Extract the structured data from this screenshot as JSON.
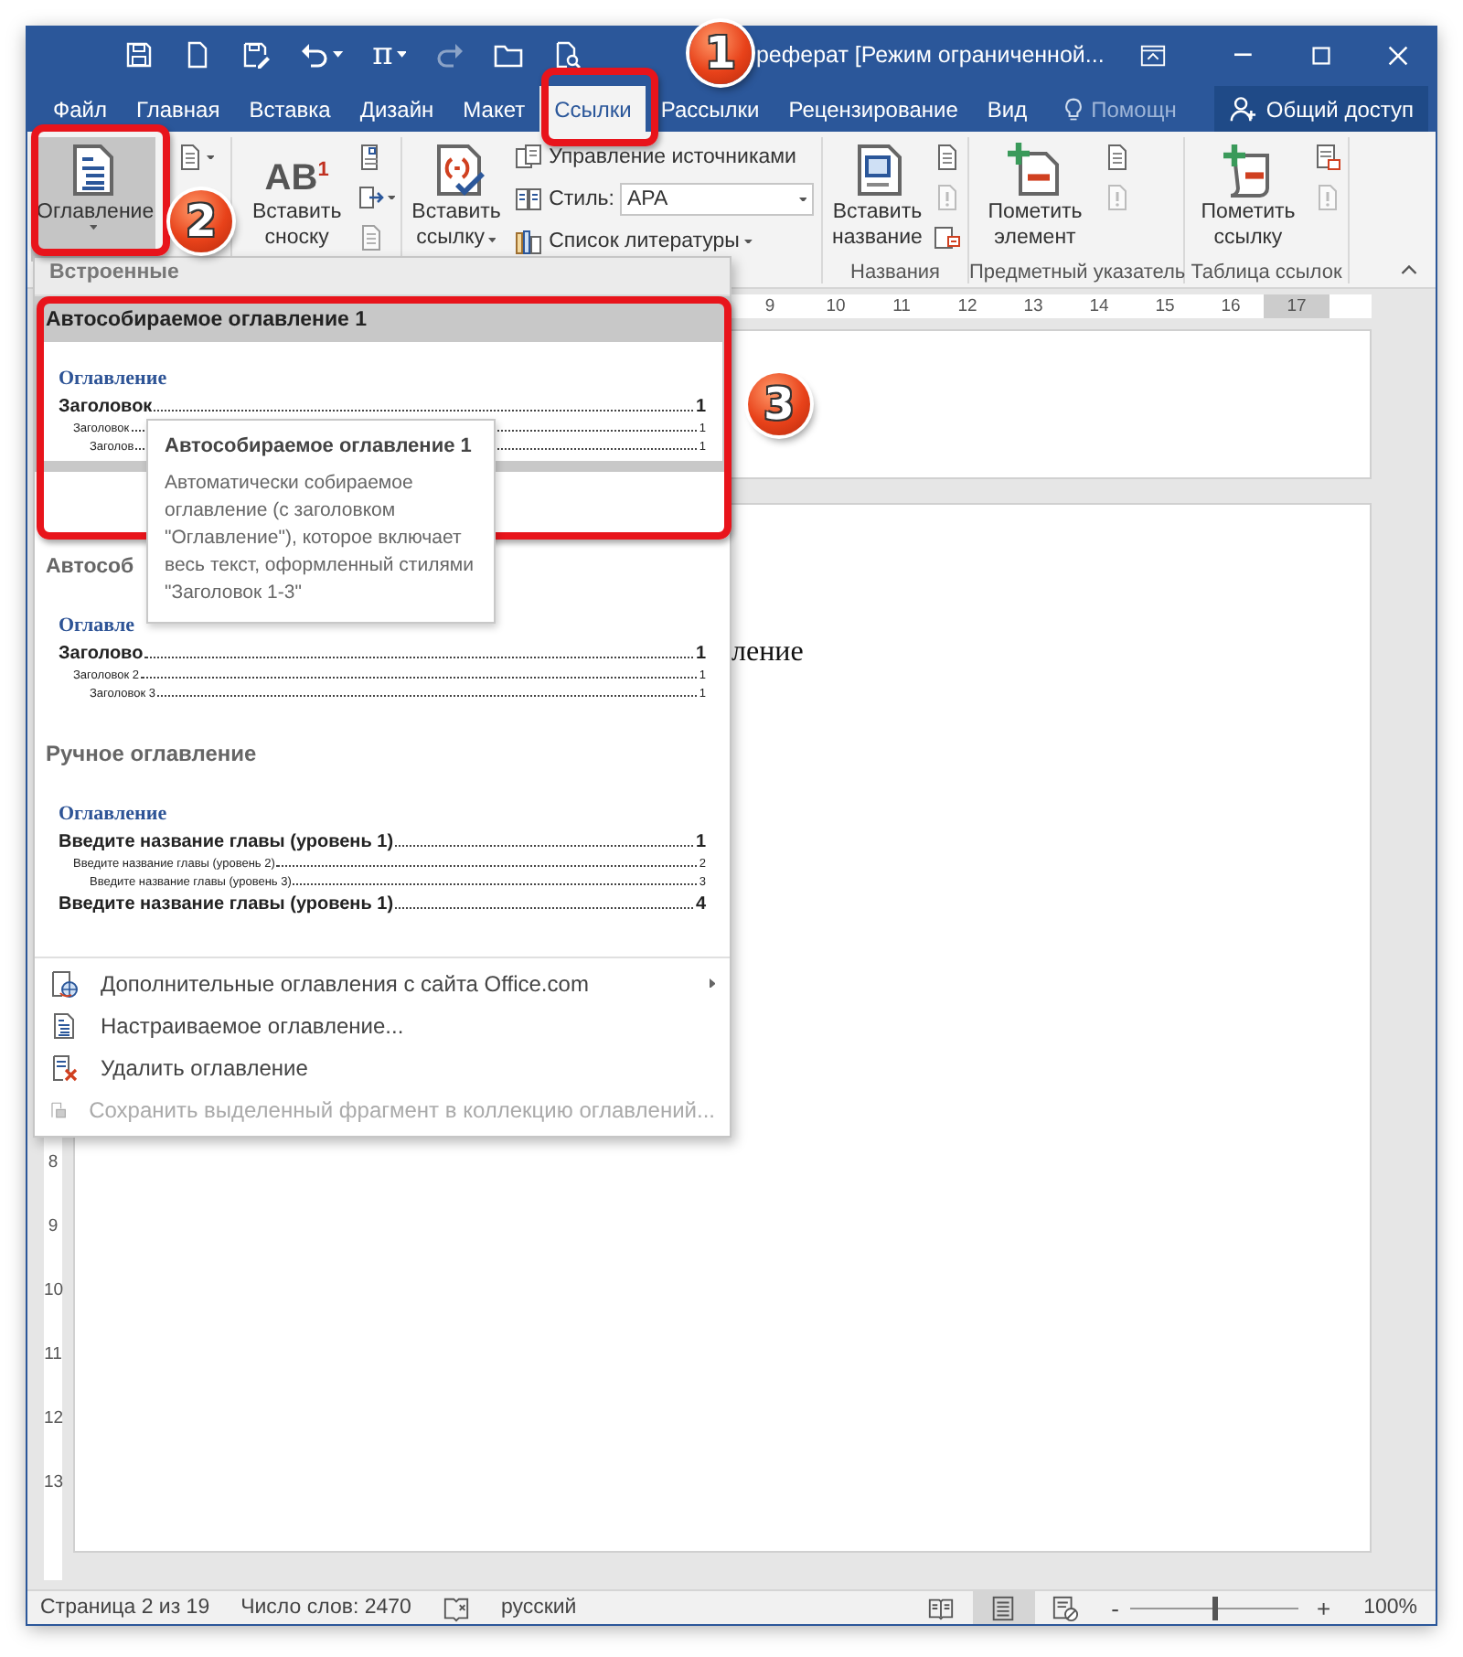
{
  "quick_access": [
    {
      "kind": "save",
      "caret": false,
      "disabled": false
    },
    {
      "kind": "new",
      "caret": false,
      "disabled": false
    },
    {
      "kind": "saveas",
      "caret": false,
      "disabled": false
    },
    {
      "kind": "undo",
      "caret": true,
      "disabled": false
    },
    {
      "kind": "equation",
      "glyph": "π",
      "caret": true,
      "disabled": false
    },
    {
      "kind": "redo",
      "caret": false,
      "disabled": true
    },
    {
      "kind": "open",
      "caret": false,
      "disabled": false
    },
    {
      "kind": "preview",
      "caret": false,
      "disabled": false
    }
  ],
  "window": {
    "title": "реферат [Режим ограниченной..."
  },
  "tabs": [
    {
      "label": "Файл",
      "selected": false
    },
    {
      "label": "Главная",
      "selected": false
    },
    {
      "label": "Вставка",
      "selected": false
    },
    {
      "label": "Дизайн",
      "selected": false
    },
    {
      "label": "Макет",
      "selected": false
    },
    {
      "label": "Ссылки",
      "selected": true
    },
    {
      "label": "Рассылки",
      "selected": false
    },
    {
      "label": "Рецензирование",
      "selected": false
    },
    {
      "label": "Вид",
      "selected": false
    }
  ],
  "tell_me": {
    "label": "Помощн"
  },
  "share": {
    "label": "Общий доступ"
  },
  "ribbon": {
    "groups": [
      {
        "large": [
          {
            "label": "Оглавление",
            "caret": true,
            "pressed": true
          }
        ],
        "small": [
          {
            "caret": true,
            "disabled": false
          }
        ]
      },
      {
        "large": [
          {
            "label": "Вставить сноску",
            "glyph": "AB$^{1}$",
            "caret": false,
            "pressed": false
          }
        ],
        "small": [
          {
            "caret": false,
            "disabled": false
          },
          {
            "caret": true,
            "disabled": false
          },
          {
            "caret": false,
            "disabled": true
          }
        ]
      },
      {
        "large": [
          {
            "label": "Вставить ссылку",
            "caret": true,
            "pressed": false
          }
        ],
        "rows": [
          {
            "kind": "button",
            "label": "Управление источниками"
          },
          {
            "kind": "combo",
            "label": "Стиль:",
            "value": "APA"
          },
          {
            "kind": "button",
            "label": "Список литературы",
            "caret": true
          }
        ]
      },
      {
        "label": "Названия",
        "large": [
          {
            "label": "Вставить название",
            "caret": false,
            "pressed": false
          }
        ],
        "small": [
          {
            "caret": false,
            "disabled": false
          },
          {
            "caret": false,
            "disabled": true
          },
          {
            "caret": false,
            "disabled": false
          }
        ]
      },
      {
        "label": "Предметный указатель",
        "large": [
          {
            "label": "Пометить элемент",
            "caret": false,
            "pressed": false
          }
        ],
        "small": [
          {
            "caret": false,
            "disabled": false
          },
          {
            "caret": false,
            "disabled": true
          }
        ]
      },
      {
        "label": "Таблица ссылок",
        "large": [
          {
            "label": "Пометить ссылку",
            "caret": false,
            "pressed": false
          }
        ],
        "small": [
          {
            "caret": false,
            "disabled": false
          },
          {
            "caret": false,
            "disabled": true
          }
        ]
      }
    ]
  },
  "toc_menu": {
    "section": "Встроенные",
    "gallery": [
      {
        "title": "Автособираемое оглавление 1",
        "selected": true,
        "heading": "Оглавление",
        "lines": [
          {
            "text": "Заголовок",
            "page": "1",
            "children": [
              {
                "text": "Заголовок",
                "page": "1",
                "children": [
                  {
                    "text": "Заголов",
                    "page": "1"
                  }
                ]
              }
            ]
          }
        ]
      },
      {
        "title": "Автособ",
        "selected": false,
        "heading": "Оглавле",
        "lines": [
          {
            "text": "Заголово",
            "page": "1",
            "children": [
              {
                "text": "Заголовок 2",
                "page": "1",
                "children": [
                  {
                    "text": "Заголовок 3",
                    "page": "1"
                  }
                ]
              }
            ]
          }
        ]
      },
      {
        "title": "Ручное оглавление",
        "selected": false,
        "heading": "Оглавление",
        "lines": [
          {
            "text": "Введите название главы (уровень 1)",
            "page": "1",
            "children": [
              {
                "text": "Введите название главы (уровень 2)",
                "page": "2",
                "children": [
                  {
                    "text": "Введите название главы (уровень 3)",
                    "page": "3"
                  }
                ]
              }
            ]
          },
          {
            "text": "Введите название главы (уровень 1)",
            "page": "4"
          }
        ]
      }
    ],
    "items": [
      {
        "label": "Дополнительные оглавления с сайта Office.com",
        "submenu": true,
        "disabled": false
      },
      {
        "label": "Настраиваемое оглавление...",
        "submenu": false,
        "disabled": false
      },
      {
        "label": "Удалить оглавление",
        "submenu": false,
        "disabled": false
      },
      {
        "label": "Сохранить выделенный фрагмент в коллекцию оглавлений...",
        "submenu": false,
        "disabled": true
      }
    ]
  },
  "tooltip": {
    "title": "Автособираемое оглавление 1",
    "body": "Автоматически собираемое оглавление (с заголовком \"Оглавление\"), которое включает весь текст, оформленный стилями \"Заголовок 1-3\""
  },
  "document": {
    "ruler": [
      "9",
      "10",
      "11",
      "12",
      "13",
      "14",
      "15",
      "16",
      "17"
    ],
    "vruler": [
      "8",
      "9",
      "10",
      "11",
      "12",
      "13"
    ],
    "text": "ление"
  },
  "status_bar": {
    "page": "Страница 2 из 19",
    "words": "Число слов: 2470",
    "language": "русский",
    "views": [
      {
        "kind": "read",
        "selected": false
      },
      {
        "kind": "print",
        "selected": true
      },
      {
        "kind": "web",
        "selected": false
      }
    ],
    "zoom": {
      "minus": "-",
      "plus": "+",
      "level": 0.5,
      "value": "100%"
    }
  },
  "annotations": [
    {
      "number": "1"
    },
    {
      "number": "2"
    },
    {
      "number": "3"
    }
  ]
}
